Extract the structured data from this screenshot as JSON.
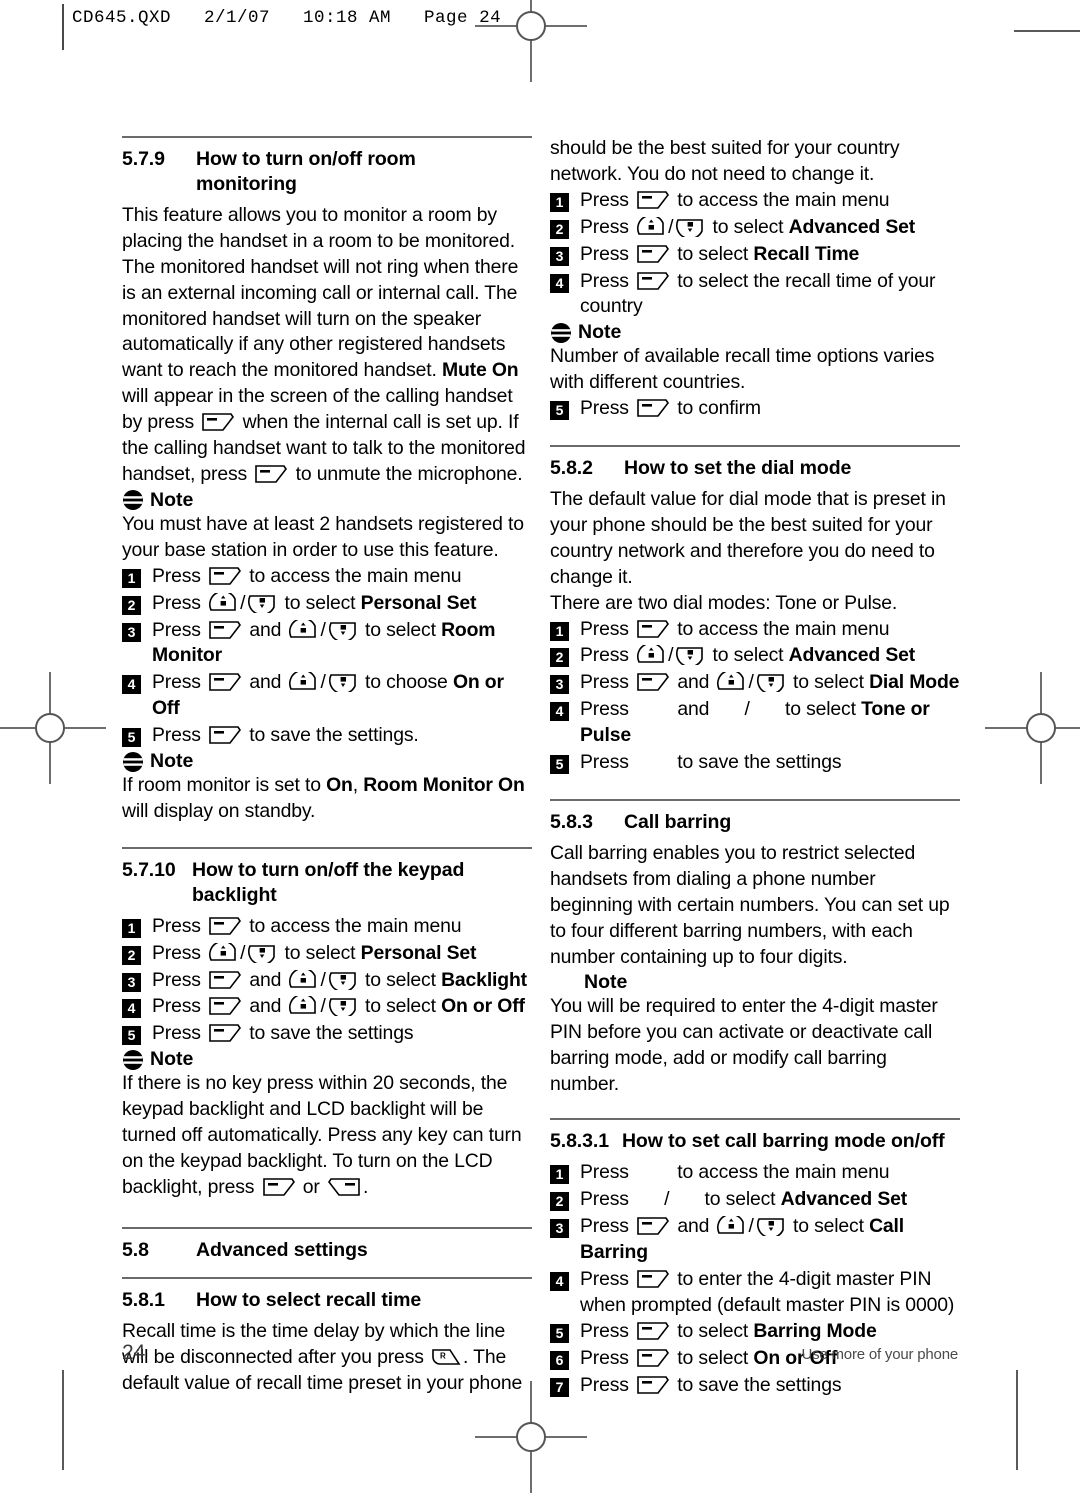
{
  "page_header": "CD645.QXD   2/1/07   10:18 AM   Page 24",
  "footer": {
    "page_number": "24",
    "running_title": "Use more of your phone"
  },
  "note_label": "Note",
  "left_column": {
    "section_5_7_9": {
      "number": "5.7.9",
      "title_line1": "How to turn on/off room",
      "title_line2": "monitoring",
      "paragraph_part1": "This feature allows you to monitor a room by placing the handset in a room to be monitored. The monitored handset will not ring when there is an external incoming call or internal call. The monitored handset will turn on the speaker automatically if any other registered handsets want to reach the monitored handset. ",
      "paragraph_bold1": "Mute On",
      "paragraph_part2": " will appear in the screen of the calling handset by press ",
      "paragraph_part3": " when the internal call is set up. If the calling handset want to talk to the monitored handset, press ",
      "paragraph_part4": " to unmute the microphone.",
      "note_text": "You must have at least 2 handsets registered to your base station in order to use this feature.",
      "steps": [
        {
          "n": "1",
          "pre": "Press ",
          "icons": [
            "soft"
          ],
          "post": " to access the main menu",
          "bold": ""
        },
        {
          "n": "2",
          "pre": "Press ",
          "icons": [
            "nav-up",
            "nav-down"
          ],
          "post": " to select ",
          "bold": "Personal Set"
        },
        {
          "n": "3",
          "pre": "Press ",
          "icons": [
            "soft",
            "and",
            "nav-up",
            "nav-down"
          ],
          "post": " to select ",
          "bold": "Room Monitor"
        },
        {
          "n": "4",
          "pre": "Press ",
          "icons": [
            "soft",
            "and",
            "nav-up",
            "nav-down"
          ],
          "post": " to choose ",
          "bold": "On or Off"
        },
        {
          "n": "5",
          "pre": "Press ",
          "icons": [
            "soft"
          ],
          "post": " to save the settings.",
          "bold": ""
        }
      ],
      "note2_part1": "If room monitor is set to ",
      "note2_bold1": "On",
      "note2_part2": ", ",
      "note2_bold2": "Room Monitor On",
      "note2_part3": " will display on standby."
    },
    "section_5_7_10": {
      "number": "5.7.10",
      "title_line1": "How to turn on/off the keypad",
      "title_line2": "backlight",
      "steps": [
        {
          "n": "1",
          "pre": "Press ",
          "post": " to access the main menu",
          "bold": ""
        },
        {
          "n": "2",
          "pre": "Press ",
          "post": " to select ",
          "bold": "Personal Set"
        },
        {
          "n": "3",
          "pre": "Press ",
          "post": " to select ",
          "bold": "Backlight"
        },
        {
          "n": "4",
          "pre": "Press ",
          "post": " to select ",
          "bold": "On or Off"
        },
        {
          "n": "5",
          "pre": "Press ",
          "post": " to save the settings",
          "bold": ""
        }
      ],
      "note_part1": "If there is no key press within 20 seconds, the keypad backlight and LCD backlight will be turned off automatically.  Press any key can turn on the keypad backlight. To turn on the LCD backlight, press ",
      "note_part2": " or ",
      "note_part3": "."
    },
    "section_5_8": {
      "number": "5.8",
      "title": "Advanced settings"
    },
    "section_5_8_1": {
      "number": "5.8.1",
      "title": "How to select recall time",
      "paragraph_part1": "Recall time is the time delay by which the line will be disconnected after you press ",
      "paragraph_part2": ". The default value of recall time preset in your phone"
    }
  },
  "right_column": {
    "section_5_8_1_cont": {
      "paragraph": "should be the best suited for your country network. You do not need to change it.",
      "steps": [
        {
          "n": "1",
          "pre": "Press ",
          "post": " to access the main menu",
          "bold": ""
        },
        {
          "n": "2",
          "pre": "Press ",
          "post": " to select ",
          "bold": "Advanced Set"
        },
        {
          "n": "3",
          "pre": "Press ",
          "post": " to select ",
          "bold": "Recall Time"
        },
        {
          "n": "4",
          "pre": "Press ",
          "post": " to select the recall time of your country",
          "bold": ""
        }
      ],
      "note_text": "Number of available recall time options varies with different countries.",
      "step5": {
        "n": "5",
        "pre": "Press ",
        "post": " to confirm"
      }
    },
    "section_5_8_2": {
      "number": "5.8.2",
      "title": "How to set the dial mode",
      "paragraph": "The default value for dial mode that is preset in your phone should be the best suited for your country network and therefore you do need to change it.",
      "paragraph2": "There are two dial modes: Tone or Pulse.",
      "steps": [
        {
          "n": "1",
          "pre": "Press ",
          "post": " to access the main menu",
          "bold": ""
        },
        {
          "n": "2",
          "pre": "Press ",
          "post": " to select ",
          "bold": "Advanced Set"
        },
        {
          "n": "3",
          "pre": "Press ",
          "post": " to select ",
          "bold": "Dial Mode"
        },
        {
          "n": "4",
          "pre": "Press ",
          "post": " to select ",
          "bold": "Tone or Pulse"
        },
        {
          "n": "5",
          "pre": "Press ",
          "post": " to save the settings",
          "bold": ""
        }
      ]
    },
    "section_5_8_3": {
      "number": "5.8.3",
      "title": "Call barring",
      "paragraph": "Call barring enables you to restrict selected handsets from dialing a phone number beginning with certain numbers. You can set up to four different barring numbers, with each number containing up to four digits.",
      "note_text": "You will be required to enter the 4-digit master PIN before you can activate or deactivate call barring mode, add or modify call barring number."
    },
    "section_5_8_3_1": {
      "number": "5.8.3.1",
      "title": "How to set call barring mode on/off",
      "steps": [
        {
          "n": "1",
          "pre": "Press ",
          "post": " to access the main menu",
          "bold": ""
        },
        {
          "n": "2",
          "pre": "Press ",
          "post": " to select ",
          "bold": "Advanced Set"
        },
        {
          "n": "3",
          "pre": "Press ",
          "post": " to select ",
          "bold": "Call Barring"
        },
        {
          "n": "4",
          "pre": "Press ",
          "post": " to enter the 4-digit master PIN when prompted (default master PIN is 0000)",
          "bold": ""
        },
        {
          "n": "5",
          "pre": "Press ",
          "post": " to select ",
          "bold": "Barring Mode"
        },
        {
          "n": "6",
          "pre": "Press ",
          "post": " to select ",
          "bold": "On or Off"
        },
        {
          "n": "7",
          "pre": "Press ",
          "post": " to save the settings",
          "bold": ""
        }
      ]
    }
  },
  "icons": {
    "soft_key": "left-softkey-icon",
    "soft_key_right": "right-softkey-icon",
    "nav_up": "nav-up-key-icon",
    "nav_down": "nav-down-key-icon",
    "recall": "recall-key-icon",
    "note": "note-icon"
  },
  "words": {
    "and": "and",
    "or": "or",
    "slash": "/"
  }
}
